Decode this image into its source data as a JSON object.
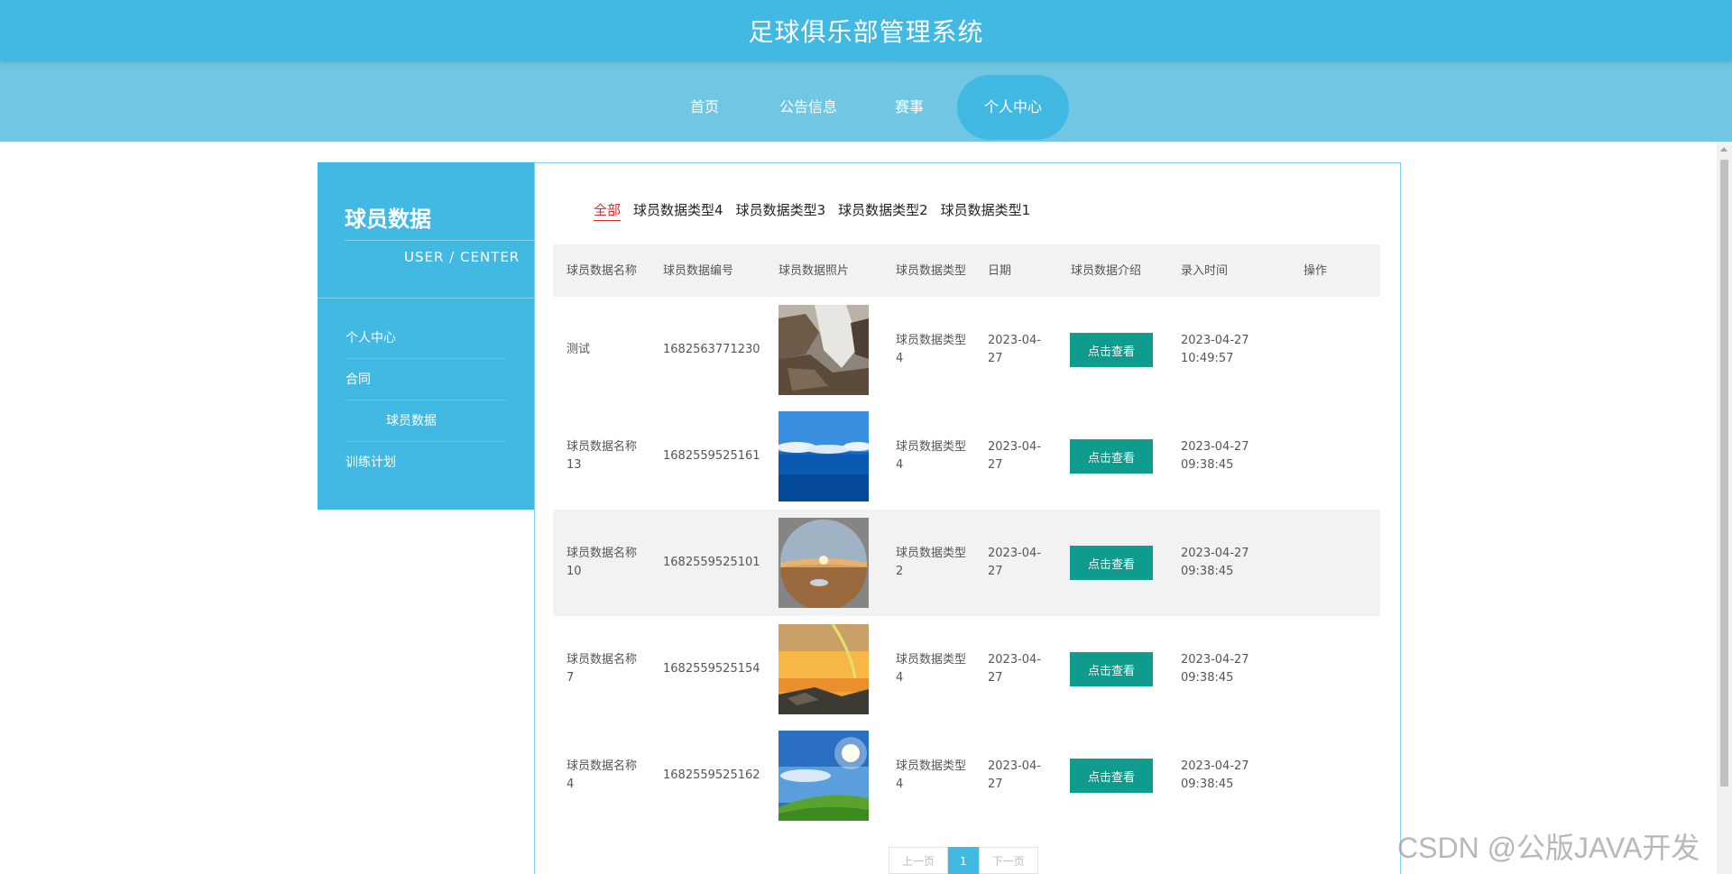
{
  "header": {
    "title": "足球俱乐部管理系统"
  },
  "nav": [
    {
      "label": "首页"
    },
    {
      "label": "公告信息"
    },
    {
      "label": "赛事"
    },
    {
      "label": "个人中心",
      "active": true
    }
  ],
  "sidebar": {
    "title": "球员数据",
    "subtitle": "USER / CENTER",
    "items": [
      {
        "label": "个人中心"
      },
      {
        "label": "合同"
      },
      {
        "label": "球员数据",
        "sub": true
      },
      {
        "label": "训练计划"
      }
    ]
  },
  "filters": [
    "全部",
    "球员数据类型4",
    "球员数据类型3",
    "球员数据类型2",
    "球员数据类型1"
  ],
  "table": {
    "headers": [
      "球员数据名称",
      "球员数据编号",
      "球员数据照片",
      "球员数据类型",
      "日期",
      "球员数据介绍",
      "录入时间",
      "操作"
    ],
    "rows": [
      {
        "name": "测试",
        "code": "1682563771230",
        "photo": "waterfall-cliff-photo",
        "type": "球员数据类型4",
        "date": "2023-04-27",
        "intro_button": "点击查看",
        "created": "2023-04-27 10:49:57"
      },
      {
        "name": "球员数据名称13",
        "code": "1682559525161",
        "photo": "blue-sea-sky-photo",
        "type": "球员数据类型4",
        "date": "2023-04-27",
        "intro_button": "点击查看",
        "created": "2023-04-27 09:38:45"
      },
      {
        "name": "球员数据名称10",
        "code": "1682559525101",
        "photo": "desert-sunset-round-photo",
        "type": "球员数据类型2",
        "date": "2023-04-27",
        "intro_button": "点击查看",
        "created": "2023-04-27 09:38:45"
      },
      {
        "name": "球员数据名称7",
        "code": "1682559525154",
        "photo": "rainbow-sunset-coast-photo",
        "type": "球员数据类型4",
        "date": "2023-04-27",
        "intro_button": "点击查看",
        "created": "2023-04-27 09:38:45"
      },
      {
        "name": "球员数据名称4",
        "code": "1682559525162",
        "photo": "green-hill-sunny-sky-photo",
        "type": "球员数据类型4",
        "date": "2023-04-27",
        "intro_button": "点击查看",
        "created": "2023-04-27 09:38:45"
      }
    ]
  },
  "pagination": {
    "prev": "上一页",
    "current": "1",
    "next": "下一页"
  },
  "watermark": "CSDN @公版JAVA开发",
  "colors": {
    "primary": "#41b9e3",
    "nav": "#71c7e3",
    "button": "#0f9b8e",
    "active_filter": "#e02b2b"
  }
}
